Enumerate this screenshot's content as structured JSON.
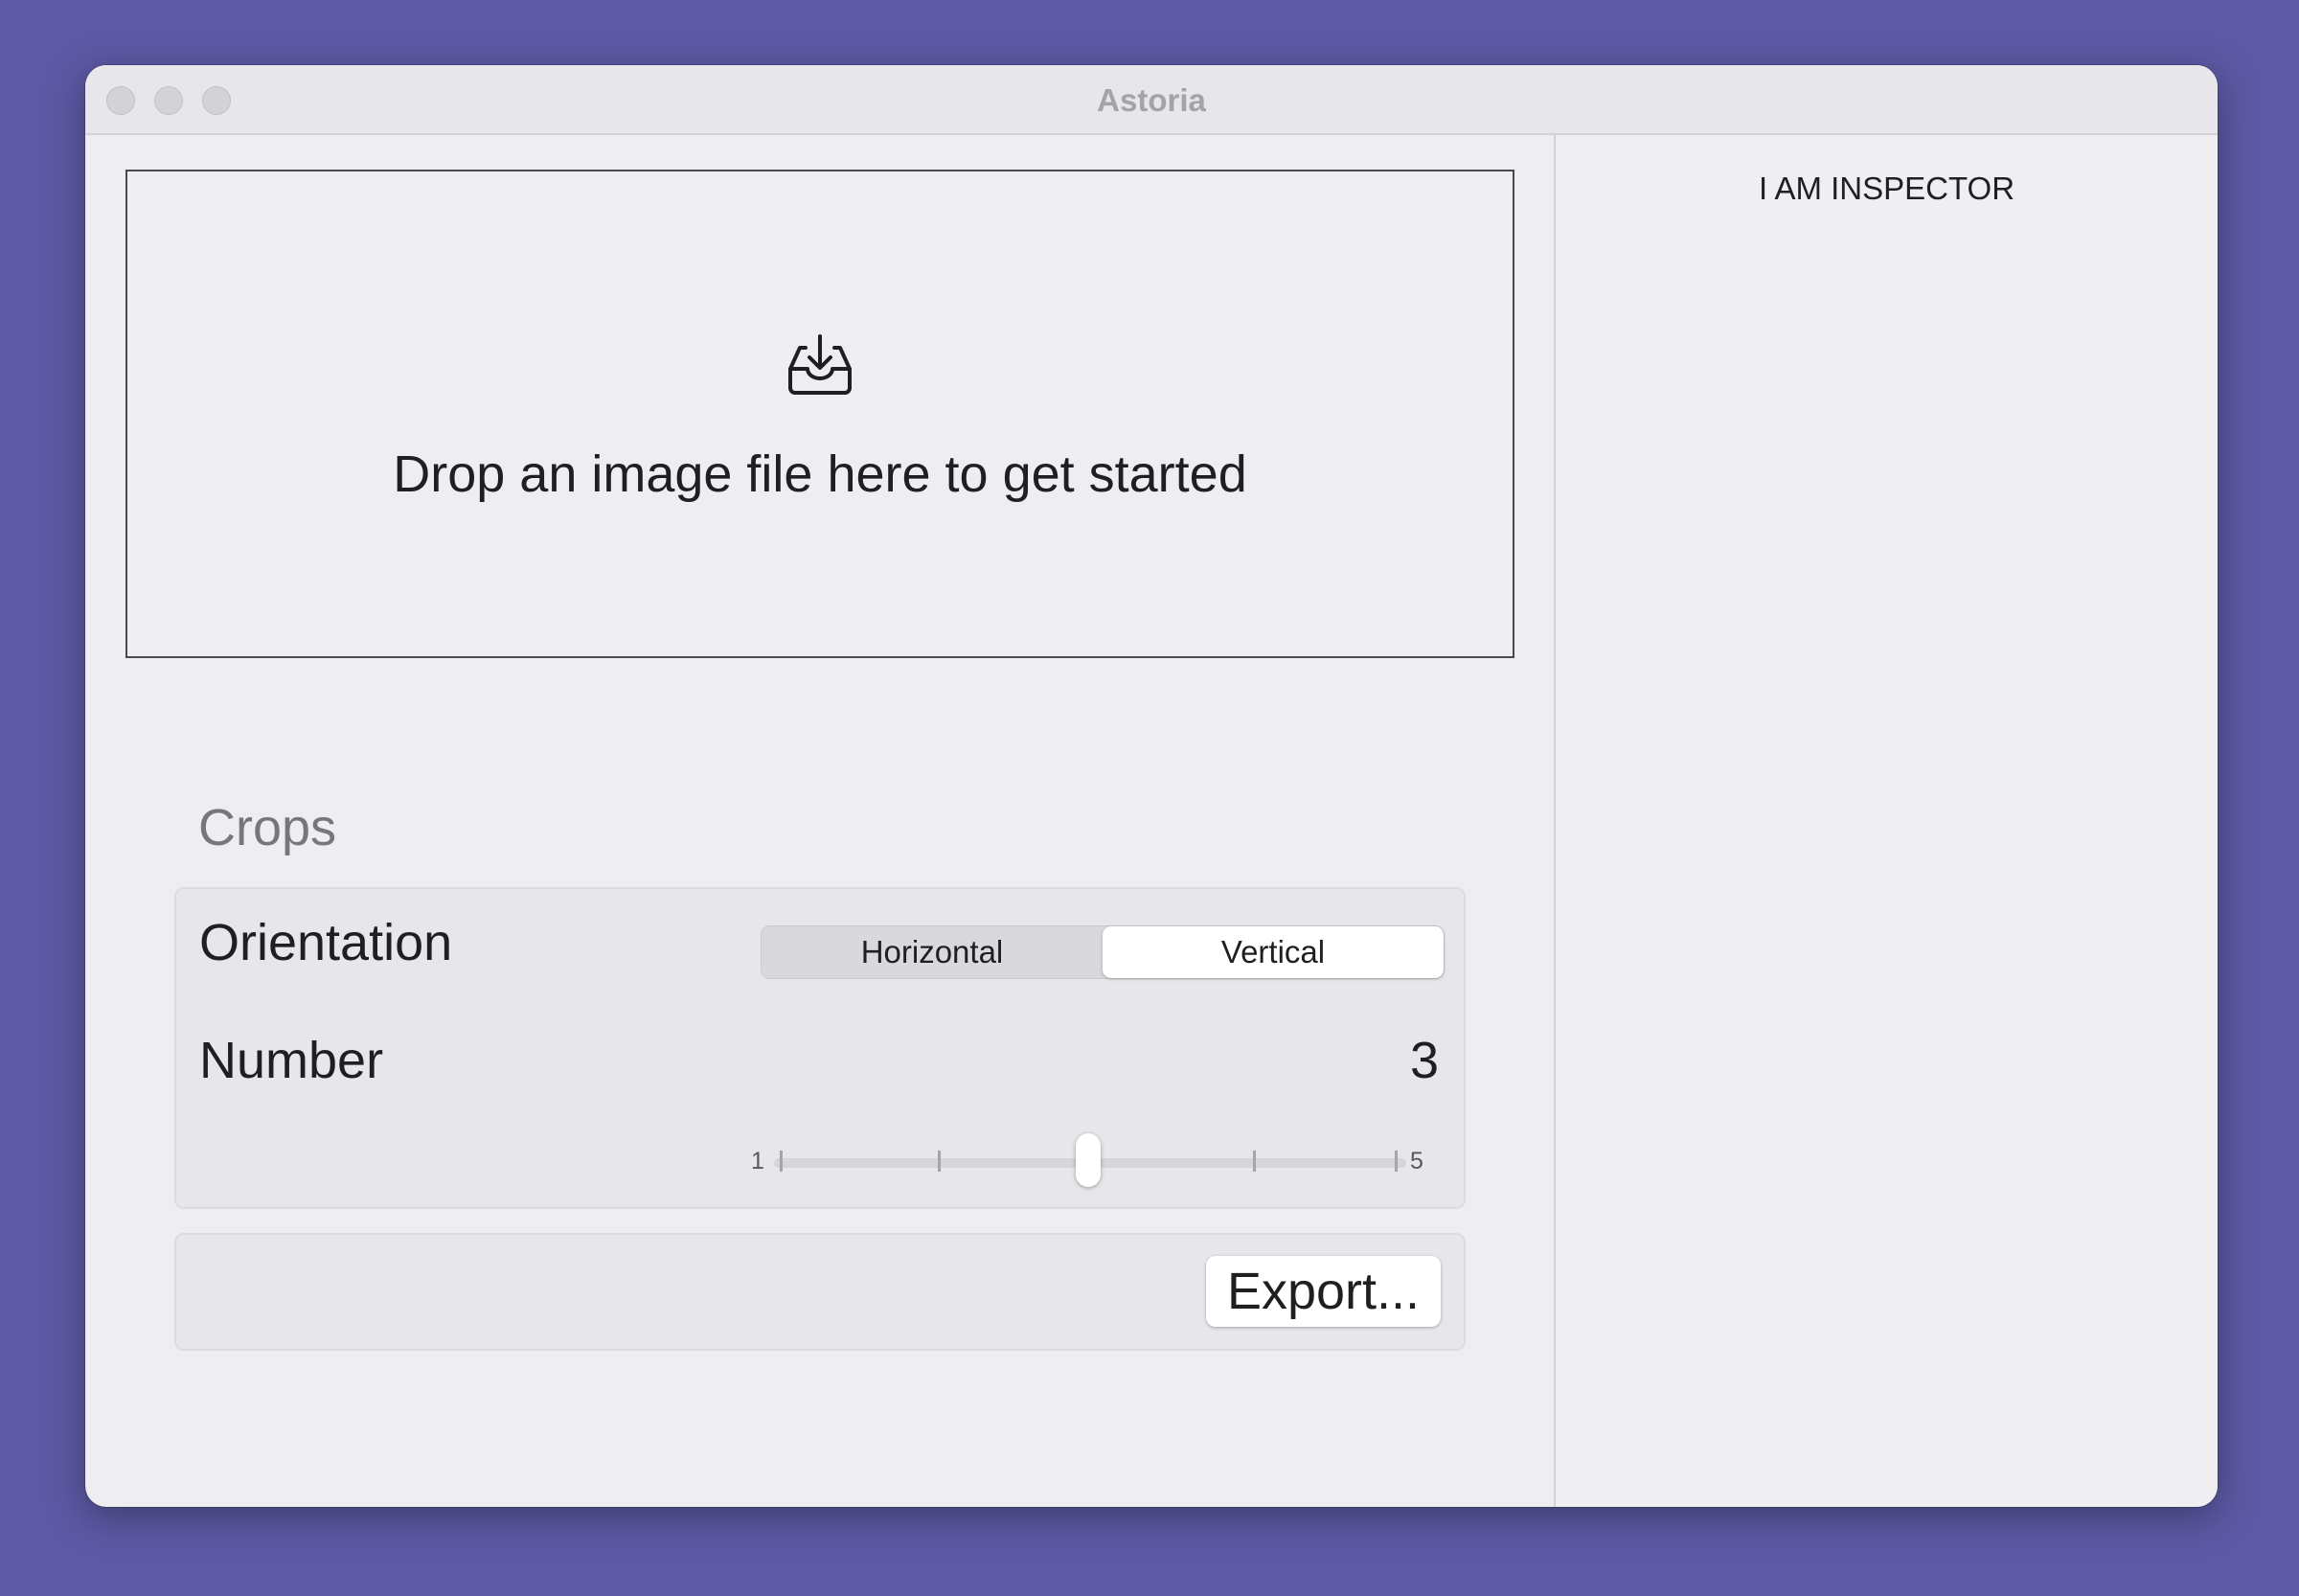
{
  "window": {
    "title": "Astoria"
  },
  "dropzone": {
    "icon": "tray-download-icon",
    "text": "Drop an image file here to get started"
  },
  "crops": {
    "section_title": "Crops",
    "orientation": {
      "label": "Orientation",
      "options": [
        "Horizontal",
        "Vertical"
      ],
      "selected": "Vertical"
    },
    "number": {
      "label": "Number",
      "value": "3",
      "min_label": "1",
      "max_label": "5",
      "min": 1,
      "max": 5,
      "current": 3
    }
  },
  "export": {
    "button_label": "Export..."
  },
  "inspector": {
    "text": "I AM INSPECTOR"
  },
  "colors": {
    "background": "#5d59a5",
    "window": "#eeedf0",
    "text": "#1f1f22",
    "section_title": "#77767b"
  }
}
